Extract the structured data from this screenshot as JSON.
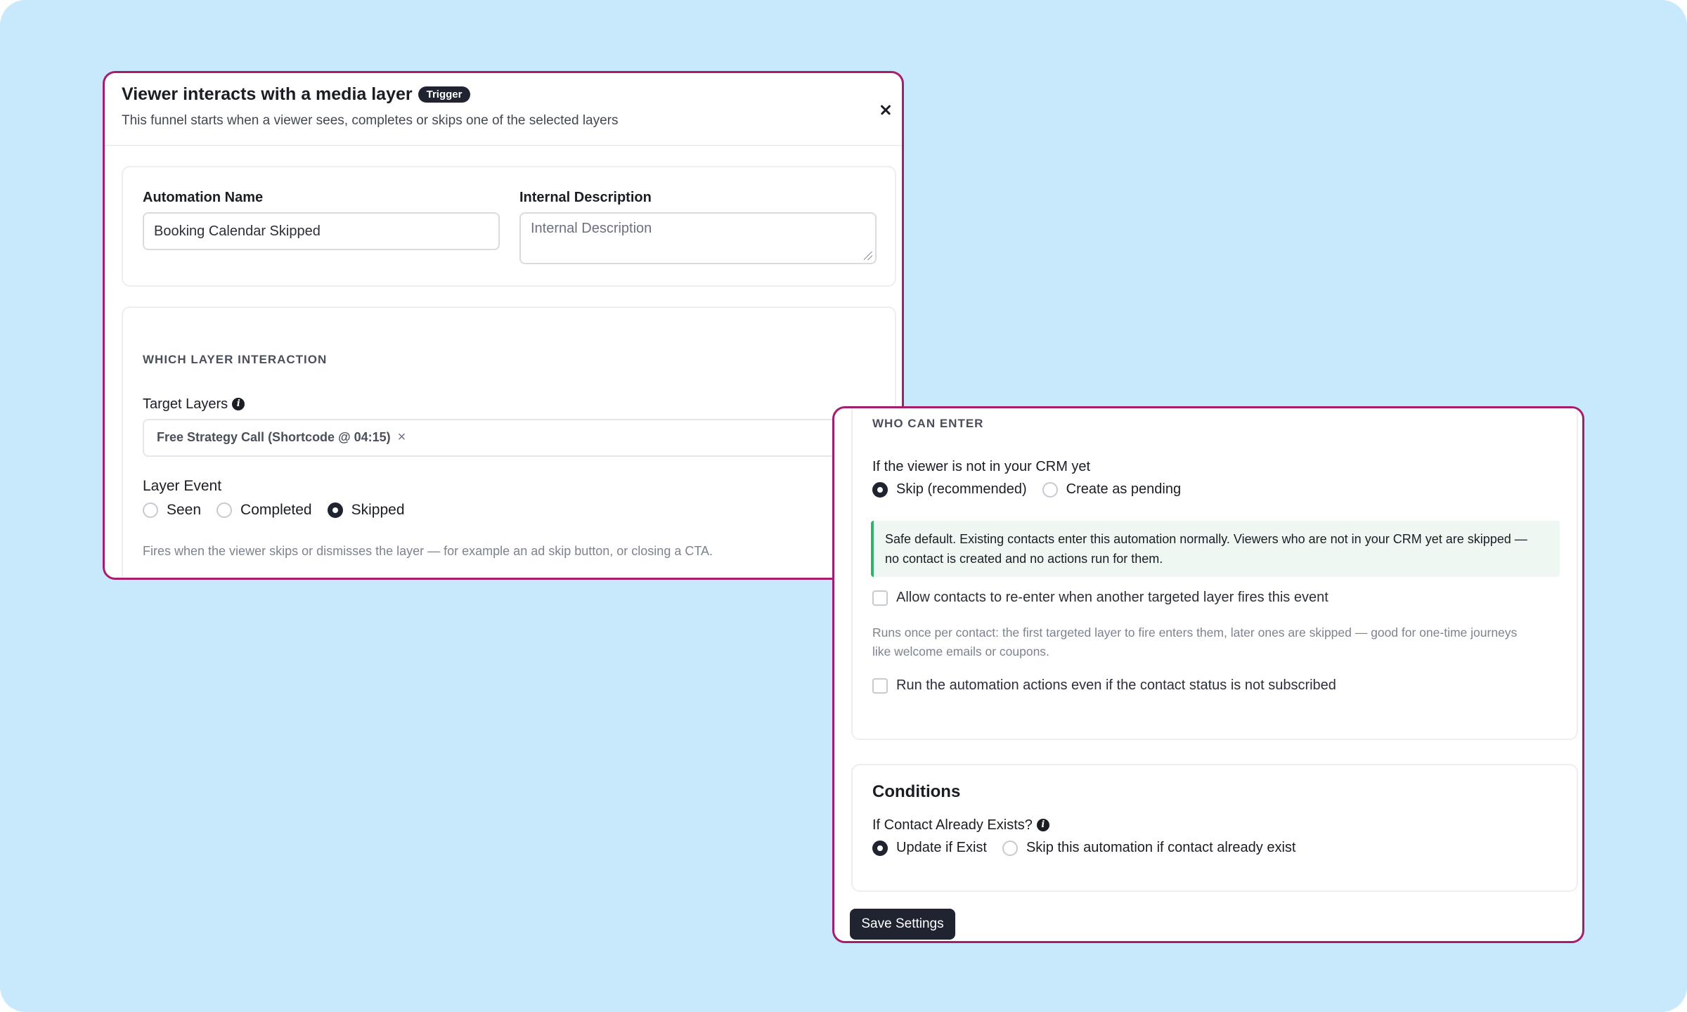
{
  "trigger_panel": {
    "title": "Viewer interacts with a media layer",
    "badge": "Trigger",
    "subtitle": "This funnel starts when a viewer sees, completes or skips one of the selected layers",
    "close_icon": "close-icon",
    "automation_name": {
      "label": "Automation Name",
      "value": "Booking Calendar Skipped"
    },
    "internal_description": {
      "label": "Internal Description",
      "placeholder": "Internal Description"
    },
    "layer_section": {
      "heading": "WHICH LAYER INTERACTION",
      "target_layers_label": "Target Layers",
      "info_icon": "info-icon",
      "selected_layer": "Free Strategy Call (Shortcode @ 04:15)",
      "chip_remove": "×",
      "layer_event_label": "Layer Event",
      "options": [
        "Seen",
        "Completed",
        "Skipped"
      ],
      "selected": "Skipped",
      "help": "Fires when the viewer skips or dismisses the layer — for example an ad skip button, or closing a CTA."
    }
  },
  "settings_panel": {
    "who_can_enter": {
      "heading": "WHO CAN ENTER",
      "crm_question": "If the viewer is not in your CRM yet",
      "options": [
        "Skip (recommended)",
        "Create as pending"
      ],
      "selected": "Skip (recommended)",
      "notice_line1": "Safe default. Existing contacts enter this automation normally. Viewers who are not in your CRM yet are skipped —",
      "notice_line2": "no contact is created and no actions run for them.",
      "reenter_label": "Allow contacts to re-enter when another targeted layer fires this event",
      "reenter_checked": false,
      "reenter_help_line1": "Runs once per contact: the first targeted layer to fire enters them, later ones are skipped — good for one-time journeys",
      "reenter_help_line2": "like welcome emails or coupons.",
      "unsubscribed_label": "Run the automation actions even if the contact status is not subscribed",
      "unsubscribed_checked": false
    },
    "conditions": {
      "heading": "Conditions",
      "question": "If Contact Already Exists?",
      "info_icon": "info-icon",
      "options": [
        "Update if Exist",
        "Skip this automation if contact already exist"
      ],
      "selected": "Update if Exist"
    },
    "save_label": "Save Settings"
  },
  "colors": {
    "background": "#c8e9fb",
    "panel_border": "#a61d6f",
    "primary_dark": "#1f2430",
    "notice_green": "#34b06d"
  }
}
